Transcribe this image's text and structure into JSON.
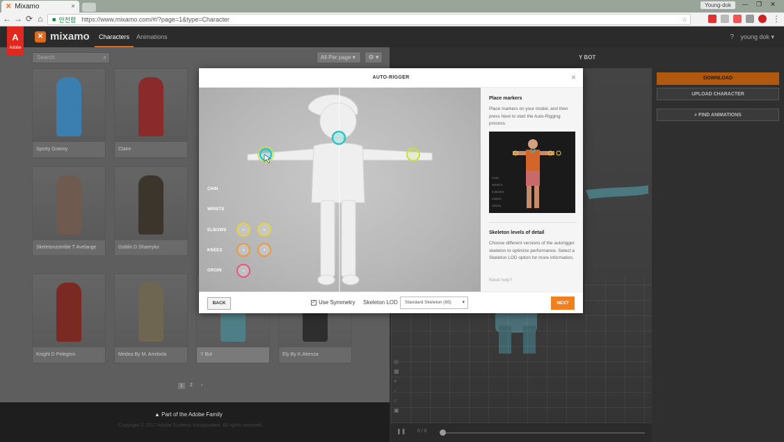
{
  "browser": {
    "tab_title": "Mixamo",
    "tab_close": "×",
    "url_secure_label": "안전함",
    "url": "https://www.mixamo.com/#/?page=1&type=Character",
    "window_user": "Young-dok",
    "window_controls": [
      "—",
      "❐",
      "✕"
    ]
  },
  "app": {
    "logo_text": "mixamo",
    "adobe_label": "Adobe",
    "nav": [
      {
        "label": "Characters",
        "active": true
      },
      {
        "label": "Animations",
        "active": false
      }
    ],
    "user": "young dok ▾",
    "help": "?"
  },
  "left": {
    "search_placeholder": "Search",
    "per_page": "All Per page ▾",
    "gear": "⚙ ▾",
    "characters": [
      {
        "name": "Sporty Granny",
        "color": "#3a7fb0"
      },
      {
        "name": "Claire",
        "color": "#8a2a2a"
      },
      {
        "name": "Skeletonzombie T Avelange",
        "color": "#6f5a50"
      },
      {
        "name": "Goblin D Shareyko",
        "color": "#3b352c"
      },
      {
        "name": "Knight D Pelegrini",
        "color": "#7a2a22"
      },
      {
        "name": "Medea By M. Arrebola",
        "color": "#6e6650"
      },
      {
        "name": "Y Bot",
        "color": "#4f7f86"
      },
      {
        "name": "Ely By K.Atienza",
        "color": "#2e2e2e"
      }
    ],
    "pages": [
      "1",
      "2",
      "›"
    ],
    "footer_text": "Part of the Adobe Family",
    "footer_sub": "Copyright © 2017 Adobe Systems Incorporated. All rights reserved."
  },
  "right": {
    "title": "Y BOT",
    "download": "DOWNLOAD",
    "upload": "UPLOAD CHARACTER",
    "find": "FIND ANIMATIONS",
    "frame": "0 / 0"
  },
  "modal": {
    "title": "AUTO-RIGGER",
    "close": "×",
    "marker_labels": [
      "CHIN",
      "WRISTS",
      "ELBOWS",
      "KNEES",
      "GROIN"
    ],
    "marker_colors": {
      "chin": "#2ec4c4",
      "wrists": "#c6e044",
      "elbows": "#e6d23a",
      "knees": "#e89a3c",
      "groin": "#e8557a"
    },
    "info": {
      "place_title": "Place markers",
      "place_text": "Place markers on your model, and then press Next to start the Auto-Rigging process.",
      "lod_title": "Skeleton levels of detail",
      "lod_text": "Choose different versions of the autorigger skeleton to optimize performance. Select a Skeleton LOD option for more information.",
      "help": "Need help?",
      "preview_legend": [
        "CHIN",
        "WRISTS",
        "ELBOWS",
        "KNEES",
        "GROIN"
      ]
    },
    "footer": {
      "back": "BACK",
      "symmetry": "Use Symmetry",
      "lod_label": "Skeleton LOD",
      "lod_value": "Standard Skeleton (65)",
      "next": "NEXT"
    }
  }
}
